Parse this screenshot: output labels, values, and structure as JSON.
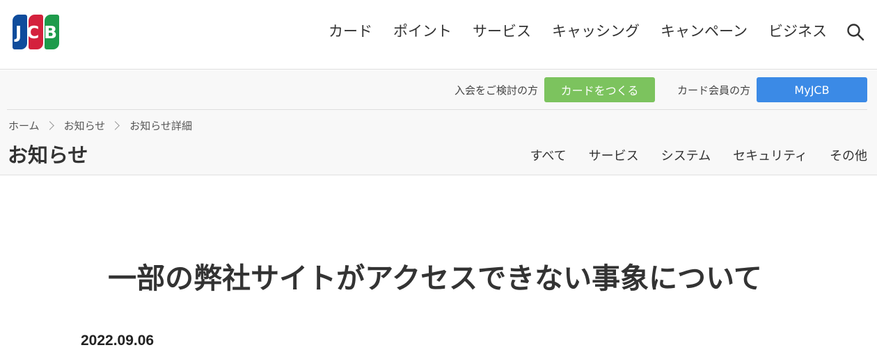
{
  "header": {
    "logo_text": [
      "J",
      "C",
      "B"
    ],
    "nav": [
      "カード",
      "ポイント",
      "サービス",
      "キャッシング",
      "キャンペーン",
      "ビジネス"
    ],
    "search_icon": "search-icon"
  },
  "cta": {
    "join_label": "入会をご検討の方",
    "join_button": "カードをつくる",
    "member_label": "カード会員の方",
    "member_button": "MyJCB"
  },
  "breadcrumb": [
    "ホーム",
    "お知らせ",
    "お知らせ詳細"
  ],
  "section": {
    "title": "お知らせ",
    "categories": [
      "すべて",
      "サービス",
      "システム",
      "セキュリティ",
      "その他"
    ]
  },
  "article": {
    "title": "一部の弊社サイトがアクセスできない事象について",
    "date": "2022.09.06"
  },
  "colors": {
    "green_button": "#7cc35e",
    "blue_button": "#3b8ae6",
    "logo_blue": "#0f4c9c",
    "logo_red": "#d4213d",
    "logo_green": "#1e9b4b"
  }
}
